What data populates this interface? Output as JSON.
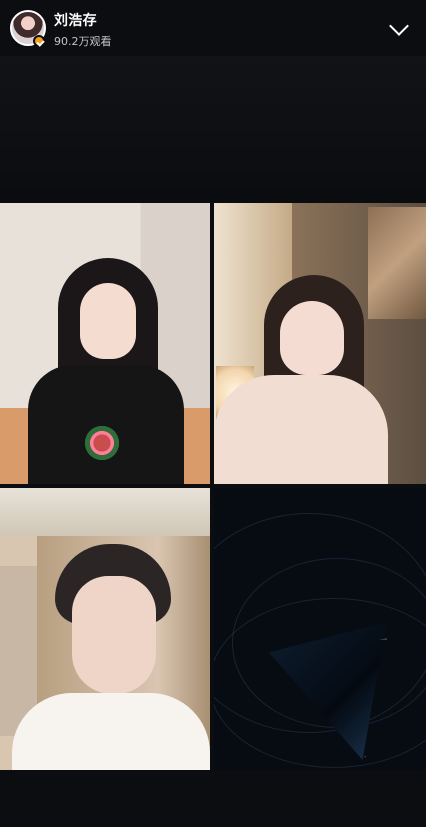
{
  "header": {
    "streamer_name": "刘浩存",
    "view_count": "90.2万观看"
  },
  "colors": {
    "background": "#0b0d10",
    "verified_badge": "#f3a01c",
    "text_primary": "#ffffff",
    "text_secondary": "#bfc3c9"
  },
  "icons": {
    "collapse": "chevron-down-icon",
    "verified": "verified-badge-icon"
  },
  "tiles": [
    {
      "id": "participant-1",
      "type": "video"
    },
    {
      "id": "participant-2",
      "type": "video"
    },
    {
      "id": "participant-3",
      "type": "video"
    },
    {
      "id": "participant-4",
      "type": "placeholder"
    }
  ]
}
